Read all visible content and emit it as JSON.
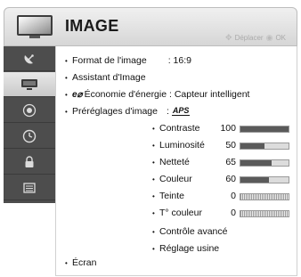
{
  "header": {
    "title": "IMAGE",
    "hint_move": "Déplacer",
    "hint_ok": "OK"
  },
  "sidebar": {
    "items": [
      {
        "icon": "satellite-dish-icon",
        "selected": false
      },
      {
        "icon": "picture-icon",
        "selected": true
      },
      {
        "icon": "speaker-icon",
        "selected": false
      },
      {
        "icon": "clock-icon",
        "selected": false
      },
      {
        "icon": "lock-icon",
        "selected": false
      },
      {
        "icon": "options-icon",
        "selected": false
      }
    ]
  },
  "menu": {
    "format_label": "Format de l'image",
    "format_value": ": 16:9",
    "wizard_label": "Assistant d'Image",
    "energy_label": "Économie d'énergie : Capteur intelligent",
    "presets_label": "Préréglages d'image",
    "presets_sep": ":",
    "presets_logo": "APS",
    "screen_label": "Écran"
  },
  "settings": [
    {
      "label": "Contraste",
      "value": "100",
      "level": 100,
      "type": "bar"
    },
    {
      "label": "Luminosité",
      "value": "50",
      "level": 50,
      "type": "bar"
    },
    {
      "label": "Netteté",
      "value": "65",
      "level": 65,
      "type": "bar"
    },
    {
      "label": "Couleur",
      "value": "60",
      "level": 60,
      "type": "bar"
    },
    {
      "label": "Teinte",
      "value": "0",
      "level": 50,
      "type": "balance"
    },
    {
      "label": "T° couleur",
      "value": "0",
      "level": 50,
      "type": "balance"
    }
  ],
  "links": {
    "advanced": "Contrôle avancé",
    "reset": "Réglage usine"
  },
  "colors": {
    "sidebar_bg": "#4d4d4d",
    "bar_fill": "#5a5a5a"
  }
}
